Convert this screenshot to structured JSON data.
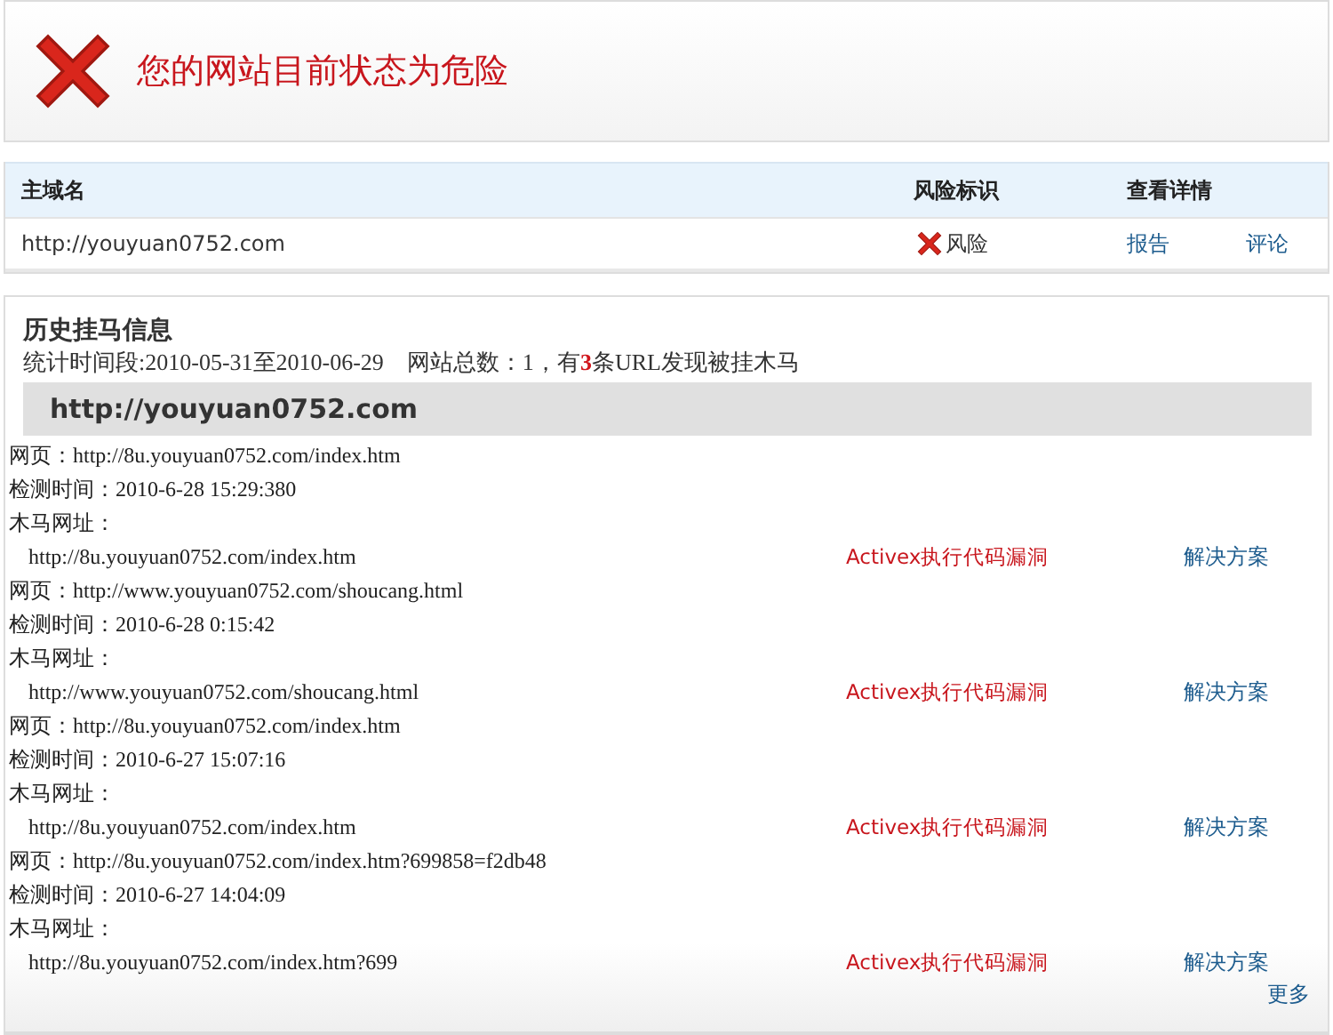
{
  "status": {
    "title": "您的网站目前状态为危险"
  },
  "domain_table": {
    "columns": [
      "主域名",
      "风险标识",
      "查看详情"
    ],
    "rows": [
      {
        "domain": "http://youyuan0752.com",
        "risk": "风险",
        "links": [
          "报告",
          "评论"
        ]
      }
    ]
  },
  "history": {
    "title": "历史挂马信息",
    "summary": "统计时间段:2010-05-31至2010-06-29　网站总数：1，有**3**条URL发现被挂木马",
    "site": "http://youyuan0752.com",
    "records": [
      {
        "page_label": "网页：",
        "page": "http://8u.youyuan0752.com/index.htm",
        "time_label": "检测时间：",
        "time": "2010-6-28 15:29:380",
        "trojan_label": "木马网址：",
        "trojan": "http://8u.youyuan0752.com/index.htm",
        "vulnerability": "Activex执行代码漏洞",
        "solution": "解决方案"
      },
      {
        "page_label": "网页：",
        "page": "http://www.youyuan0752.com/shoucang.html",
        "time_label": "检测时间：",
        "time": "2010-6-28 0:15:42",
        "trojan_label": "木马网址：",
        "trojan": "http://www.youyuan0752.com/shoucang.html",
        "vulnerability": "Activex执行代码漏洞",
        "solution": "解决方案"
      },
      {
        "page_label": "网页：",
        "page": "http://8u.youyuan0752.com/index.htm",
        "time_label": "检测时间：",
        "time": "2010-6-27 15:07:16",
        "trojan_label": "木马网址：",
        "trojan": "http://8u.youyuan0752.com/index.htm",
        "vulnerability": "Activex执行代码漏洞",
        "solution": "解决方案"
      },
      {
        "page_label": "网页：",
        "page": "http://8u.youyuan0752.com/index.htm?699858=f2db48",
        "time_label": "检测时间：",
        "time": "2010-6-27 14:04:09",
        "trojan_label": "木马网址：",
        "trojan": "http://8u.youyuan0752.com/index.htm?699",
        "vulnerability": "Activex执行代码漏洞",
        "solution": "解决方案"
      }
    ],
    "more": "更多"
  }
}
